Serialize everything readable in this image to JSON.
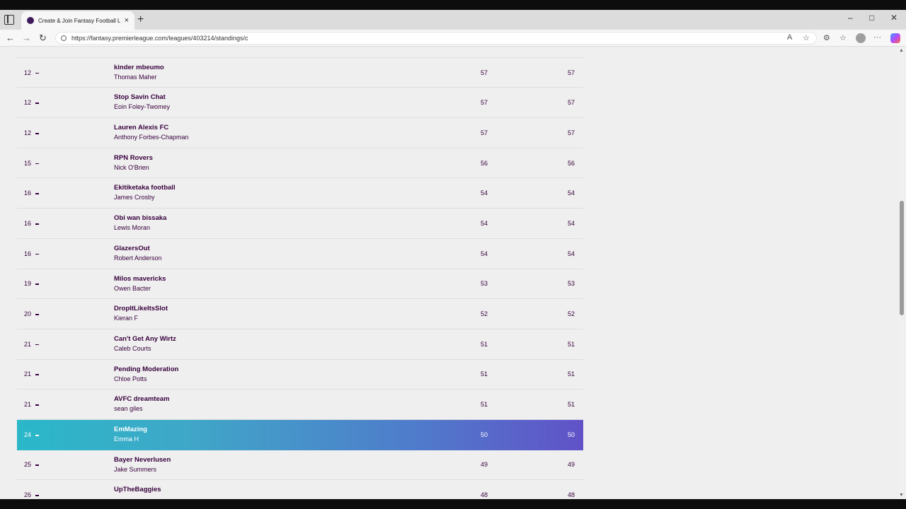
{
  "browser": {
    "tab_title": "Create & Join Fantasy Football Le",
    "tab_close": "×",
    "new_tab": "+",
    "url": "https://fantasy.premierleague.com/leagues/403214/standings/c",
    "window_controls": {
      "minimize": "–",
      "maximize": "□",
      "close": "✕"
    },
    "nav": {
      "back": "←",
      "forward": "→",
      "refresh": "↻"
    },
    "right_icons": {
      "read_aloud": "A",
      "favorite": "☆",
      "extensions": "⚙",
      "collections": "☆",
      "more": "···"
    }
  },
  "standings": [
    {
      "rank": "12",
      "team": "kinder mbeumo",
      "manager": "Thomas Maher",
      "gw": "57",
      "total": "57"
    },
    {
      "rank": "12",
      "team": "Stop Savin Chat",
      "manager": "Eoin Foley-Twomey",
      "gw": "57",
      "total": "57"
    },
    {
      "rank": "12",
      "team": "Lauren Alexis FC",
      "manager": "Anthony Forbes-Chapman",
      "gw": "57",
      "total": "57"
    },
    {
      "rank": "15",
      "team": "RPN Rovers",
      "manager": "Nick O'Brien",
      "gw": "56",
      "total": "56"
    },
    {
      "rank": "16",
      "team": "Ekitiketaka football",
      "manager": "James Crosby",
      "gw": "54",
      "total": "54"
    },
    {
      "rank": "16",
      "team": "Obi wan bissaka",
      "manager": "Lewis Moran",
      "gw": "54",
      "total": "54"
    },
    {
      "rank": "16",
      "team": "GlazersOut",
      "manager": "Robert Anderson",
      "gw": "54",
      "total": "54"
    },
    {
      "rank": "19",
      "team": "Milos mavericks",
      "manager": "Owen Bacter",
      "gw": "53",
      "total": "53"
    },
    {
      "rank": "20",
      "team": "DropItLikeItsSlot",
      "manager": "Kieran F",
      "gw": "52",
      "total": "52"
    },
    {
      "rank": "21",
      "team": "Can't Get Any Wirtz",
      "manager": "Caleb Courts",
      "gw": "51",
      "total": "51"
    },
    {
      "rank": "21",
      "team": "Pending Moderation",
      "manager": "Chloe Potts",
      "gw": "51",
      "total": "51"
    },
    {
      "rank": "21",
      "team": "AVFC dreamteam",
      "manager": "sean giles",
      "gw": "51",
      "total": "51"
    },
    {
      "rank": "24",
      "team": "EmMazing",
      "manager": "Emma H",
      "gw": "50",
      "total": "50"
    },
    {
      "rank": "25",
      "team": "Bayer Neverlusen",
      "manager": "Jake Summers",
      "gw": "49",
      "total": "49"
    },
    {
      "rank": "26",
      "team": "UpTheBaggies",
      "manager": "",
      "gw": "48",
      "total": "48"
    }
  ]
}
